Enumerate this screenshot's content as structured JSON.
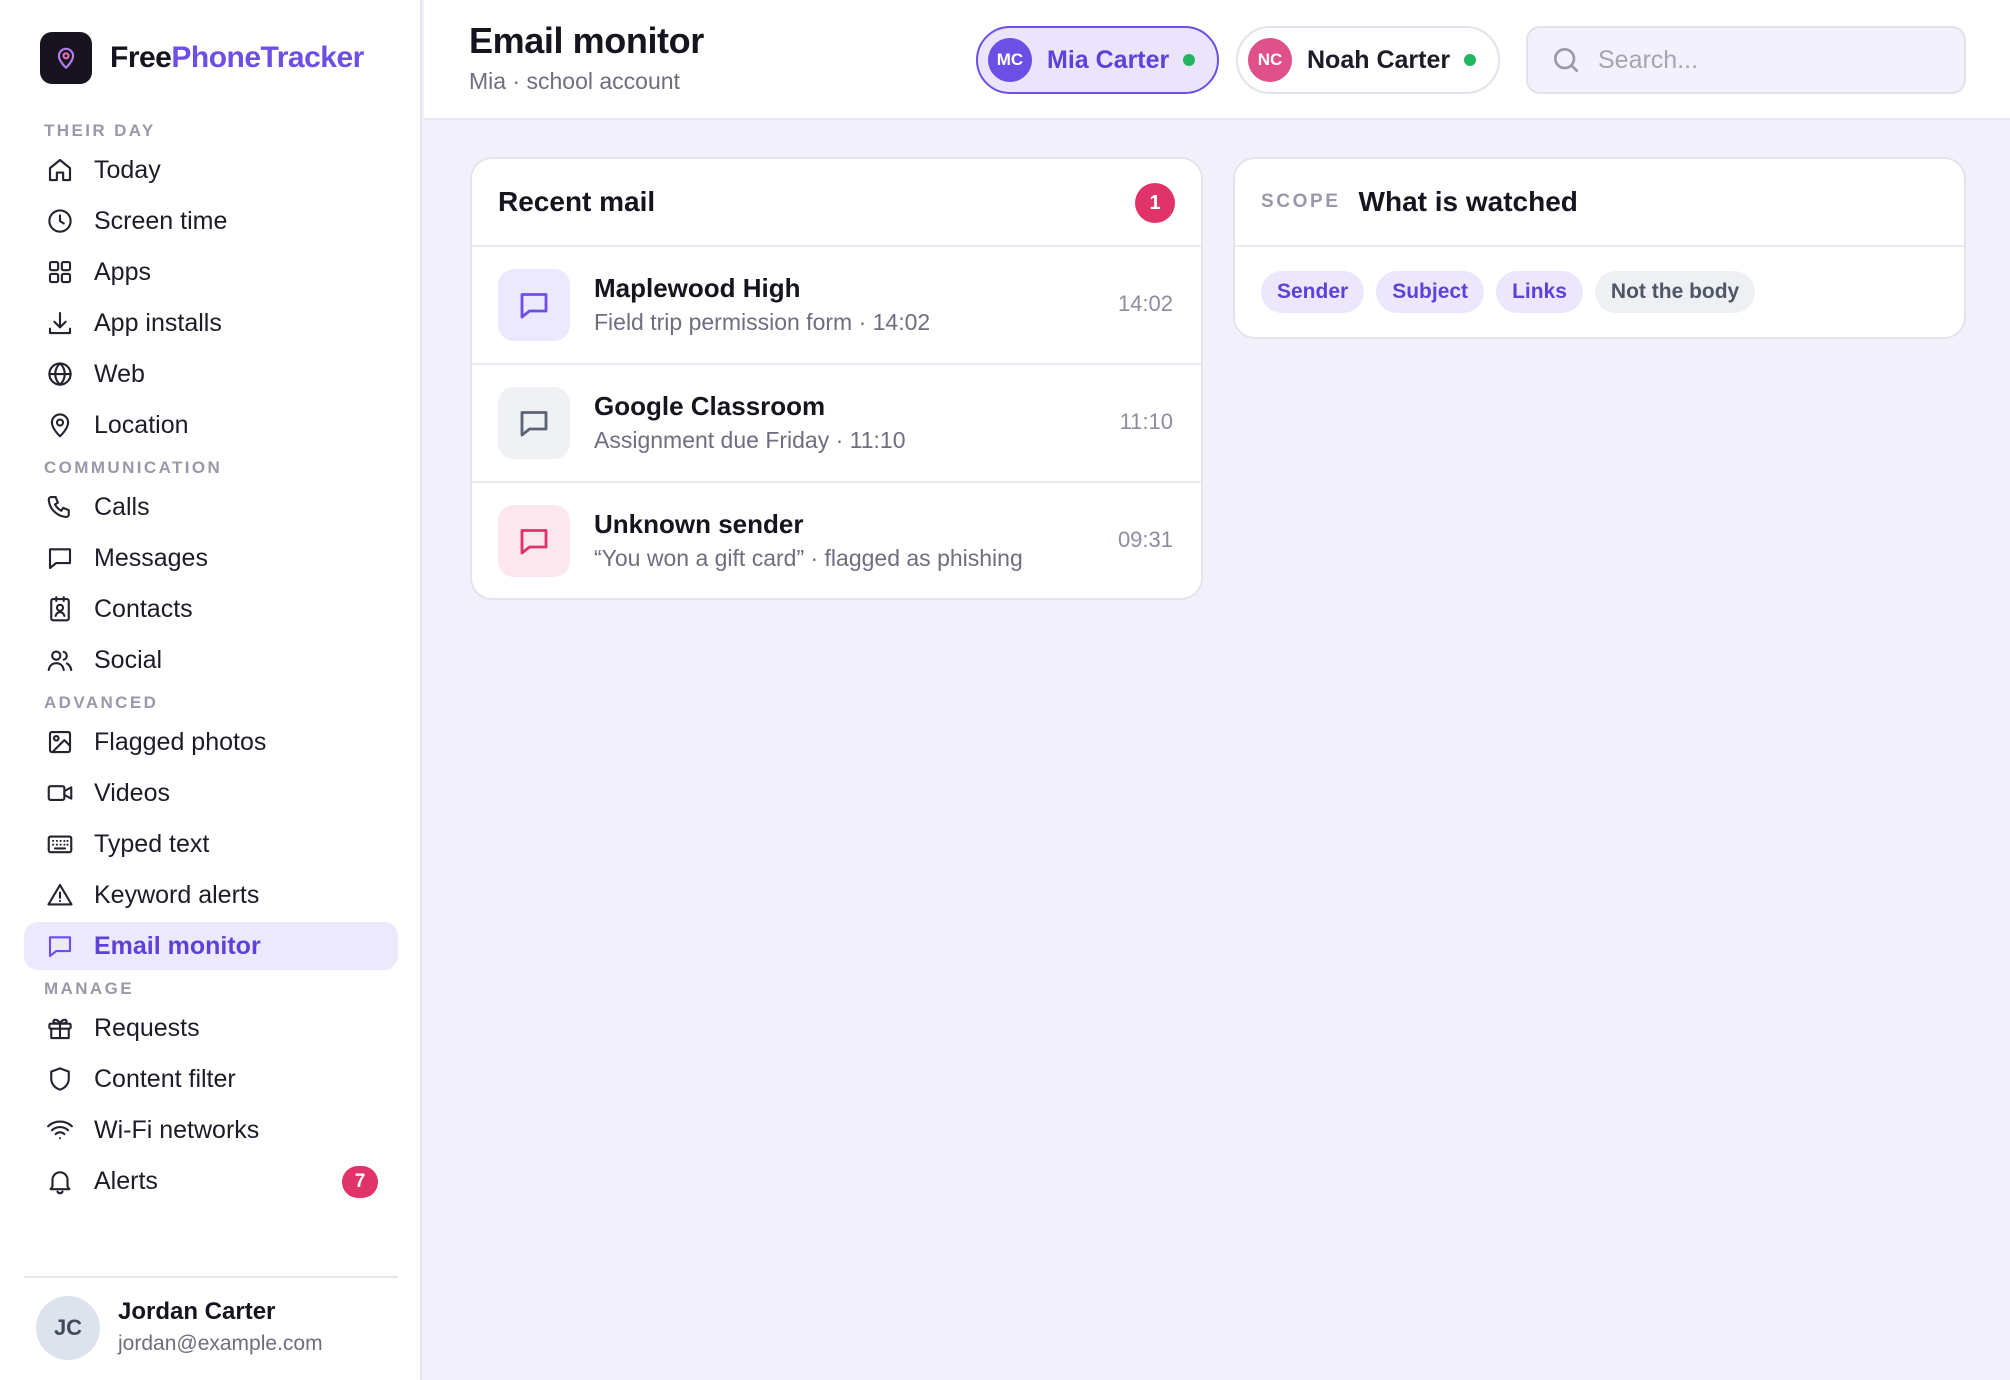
{
  "brand": {
    "part1": "Free",
    "part2": "PhoneTracker",
    "accent": "#6d4fe6"
  },
  "nav": {
    "sections": [
      {
        "title": "THEIR DAY",
        "items": [
          {
            "label": "Today",
            "icon": "home-icon"
          },
          {
            "label": "Screen time",
            "icon": "clock-icon"
          },
          {
            "label": "Apps",
            "icon": "grid-icon"
          },
          {
            "label": "App installs",
            "icon": "download-icon"
          },
          {
            "label": "Web",
            "icon": "globe-icon"
          },
          {
            "label": "Location",
            "icon": "map-pin-icon"
          }
        ]
      },
      {
        "title": "COMMUNICATION",
        "items": [
          {
            "label": "Calls",
            "icon": "phone-icon"
          },
          {
            "label": "Messages",
            "icon": "message-icon"
          },
          {
            "label": "Contacts",
            "icon": "contact-card-icon"
          },
          {
            "label": "Social",
            "icon": "users-icon"
          }
        ]
      },
      {
        "title": "ADVANCED",
        "items": [
          {
            "label": "Flagged photos",
            "icon": "image-icon"
          },
          {
            "label": "Videos",
            "icon": "video-icon"
          },
          {
            "label": "Typed text",
            "icon": "keyboard-icon"
          },
          {
            "label": "Keyword alerts",
            "icon": "warning-icon"
          },
          {
            "label": "Email monitor",
            "icon": "message-icon",
            "active": true
          }
        ]
      },
      {
        "title": "MANAGE",
        "items": [
          {
            "label": "Requests",
            "icon": "gift-icon"
          },
          {
            "label": "Content filter",
            "icon": "shield-icon"
          },
          {
            "label": "Wi-Fi networks",
            "icon": "wifi-icon"
          },
          {
            "label": "Alerts",
            "icon": "bell-icon",
            "badge": "7"
          }
        ]
      }
    ]
  },
  "user": {
    "initials": "JC",
    "name": "Jordan Carter",
    "email": "jordan@example.com"
  },
  "header": {
    "title": "Email monitor",
    "subtitle": "Mia · school account",
    "children": [
      {
        "initials": "MC",
        "name": "Mia Carter",
        "active": true,
        "color": "#6d4fe6"
      },
      {
        "initials": "NC",
        "name": "Noah Carter",
        "active": false,
        "color": "#e0508a"
      }
    ],
    "search_placeholder": "Search..."
  },
  "recent_mail": {
    "title": "Recent mail",
    "count": "1",
    "items": [
      {
        "from": "Maplewood High",
        "summary": "Field trip permission form · 14:02",
        "time": "14:02",
        "tone": "purple"
      },
      {
        "from": "Google Classroom",
        "summary": "Assignment due Friday · 11:10",
        "time": "11:10",
        "tone": "gray"
      },
      {
        "from": "Unknown sender",
        "summary": "“You won a gift card” · flagged as phishing",
        "time": "09:31",
        "tone": "pink"
      }
    ]
  },
  "scope": {
    "kicker": "SCOPE",
    "title": "What is watched",
    "chips": [
      {
        "label": "Sender",
        "on": true
      },
      {
        "label": "Subject",
        "on": true
      },
      {
        "label": "Links",
        "on": true
      },
      {
        "label": "Not the body",
        "on": false
      }
    ]
  }
}
